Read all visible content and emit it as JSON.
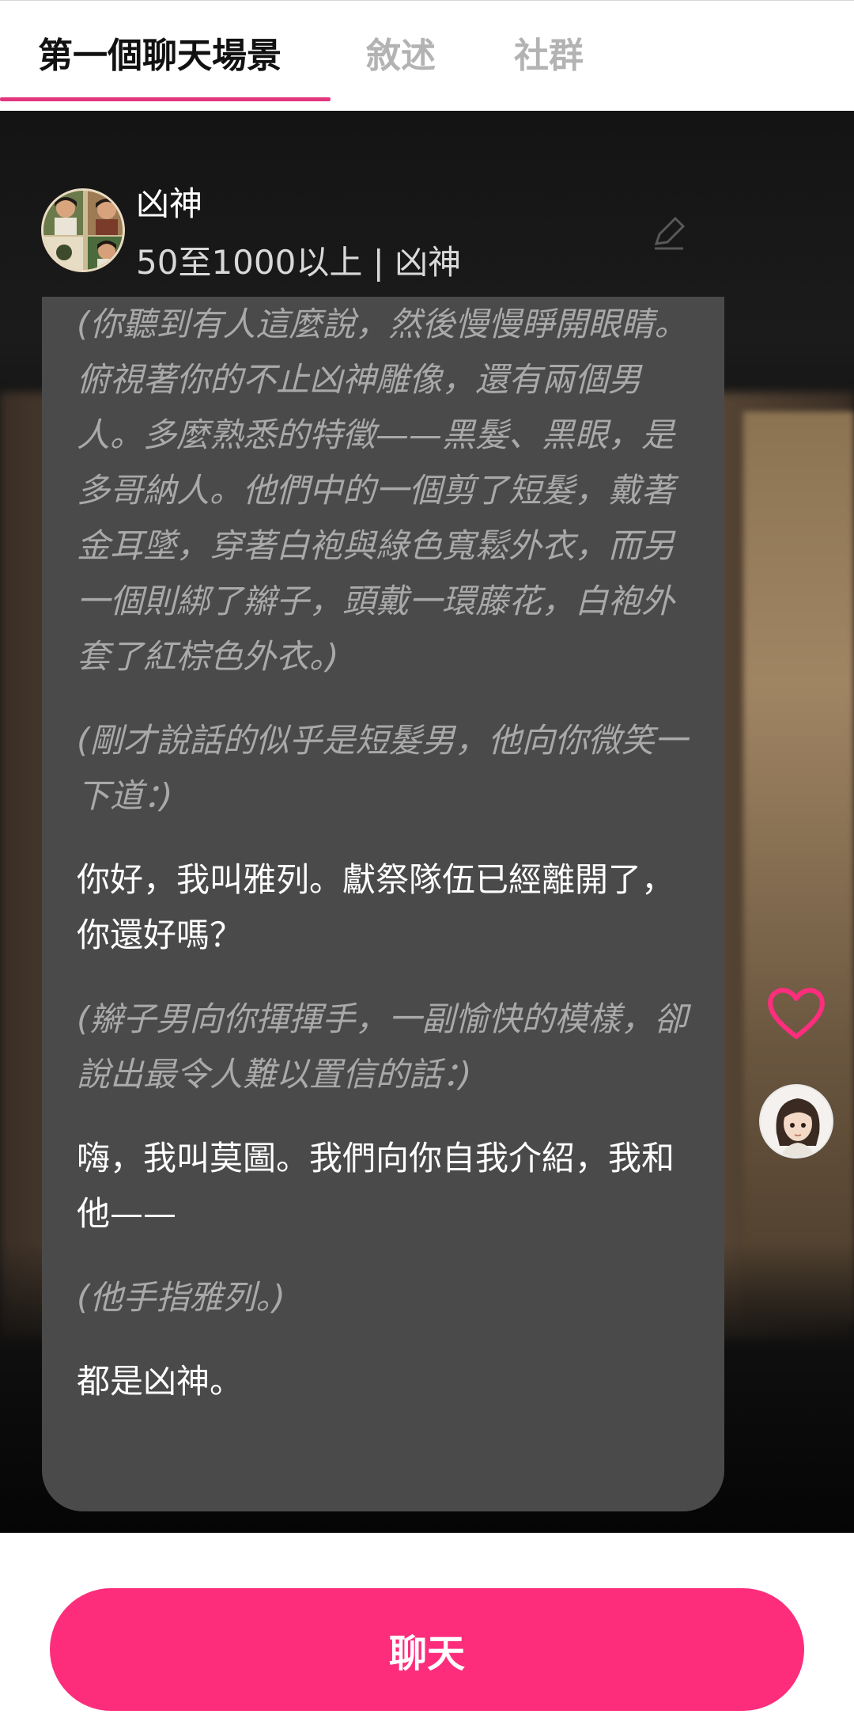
{
  "tabs": [
    {
      "label": "第一個聊天場景",
      "active": true
    },
    {
      "label": "敘述",
      "active": false
    },
    {
      "label": "社群",
      "active": false
    }
  ],
  "character": {
    "name": "凶神",
    "subtitle": "50至1000以上 | 凶神",
    "avatar_icon": "character-group-avatar"
  },
  "messages": [
    {
      "type": "narration",
      "text": "(你聽到有人這麼說，然後慢慢睜開眼睛。俯視著你的不止凶神雕像，還有兩個男人。多麼熟悉的特徵——黑髮、黑眼，是多哥納人。他們中的一個剪了短髮，戴著金耳墜，穿著白袍與綠色寬鬆外衣，而另一個則綁了辮子，頭戴一環藤花，白袍外套了紅棕色外衣。)"
    },
    {
      "type": "narration",
      "text": "(剛才說話的似乎是短髮男，他向你微笑一下道：)"
    },
    {
      "type": "speech",
      "text": "你好，我叫雅列。獻祭隊伍已經離開了，你還好嗎？"
    },
    {
      "type": "narration",
      "text": "(辮子男向你揮揮手，一副愉快的模樣，卻說出最令人難以置信的話：)"
    },
    {
      "type": "speech",
      "text": "嗨，我叫莫圖。我們向你自我介紹，我和他——"
    },
    {
      "type": "narration",
      "text": "(他手指雅列。)"
    },
    {
      "type": "speech",
      "text": "都是凶神。"
    }
  ],
  "side": {
    "heart_icon": "heart-outline-icon",
    "user_avatar_icon": "user-avatar"
  },
  "bottom": {
    "chat_label": "聊天"
  },
  "colors": {
    "accent": "#fd2d7c",
    "tab_underline": "#e2357d",
    "card_bg": "#4a4a4a",
    "narration_text": "#a9a9a9"
  }
}
